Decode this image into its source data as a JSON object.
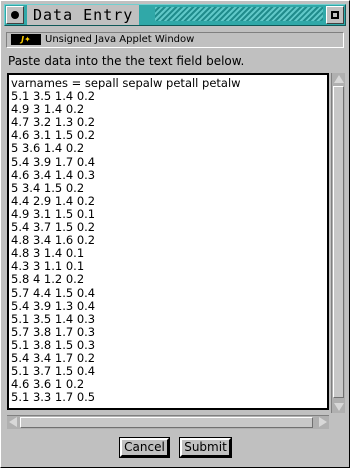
{
  "window": {
    "title": "Data Entry",
    "applet_warning": "Unsigned Java Applet Window",
    "java_badge": "J"
  },
  "instruction": "Paste data into the the text field below.",
  "text_field": {
    "lines": [
      "varnames = sepall sepalw petall petalw",
      "5.1 3.5 1.4 0.2",
      "4.9 3 1.4 0.2",
      "4.7 3.2 1.3 0.2",
      "4.6 3.1 1.5 0.2",
      "5 3.6 1.4 0.2",
      "5.4 3.9 1.7 0.4",
      "4.6 3.4 1.4 0.3",
      "5 3.4 1.5 0.2",
      "4.4 2.9 1.4 0.2",
      "4.9 3.1 1.5 0.1",
      "5.4 3.7 1.5 0.2",
      "4.8 3.4 1.6 0.2",
      "4.8 3 1.4 0.1",
      "4.3 3 1.1 0.1",
      "5.8 4 1.2 0.2",
      "5.7 4.4 1.5 0.4",
      "5.4 3.9 1.3 0.4",
      "5.1 3.5 1.4 0.3",
      "5.7 3.8 1.7 0.3",
      "5.1 3.8 1.5 0.3",
      "5.4 3.4 1.7 0.2",
      "5.1 3.7 1.5 0.4",
      "4.6 3.6 1 0.2",
      "5.1 3.3 1.7 0.5"
    ]
  },
  "buttons": {
    "cancel": "Cancel",
    "submit": "Submit"
  },
  "icons": {
    "window_menu": "window-menu-icon",
    "maximize": "maximize-icon",
    "java": "java-icon"
  },
  "colors": {
    "titlebar": "#30a8a8",
    "background": "#c0c0c0",
    "field": "#ffffff"
  }
}
